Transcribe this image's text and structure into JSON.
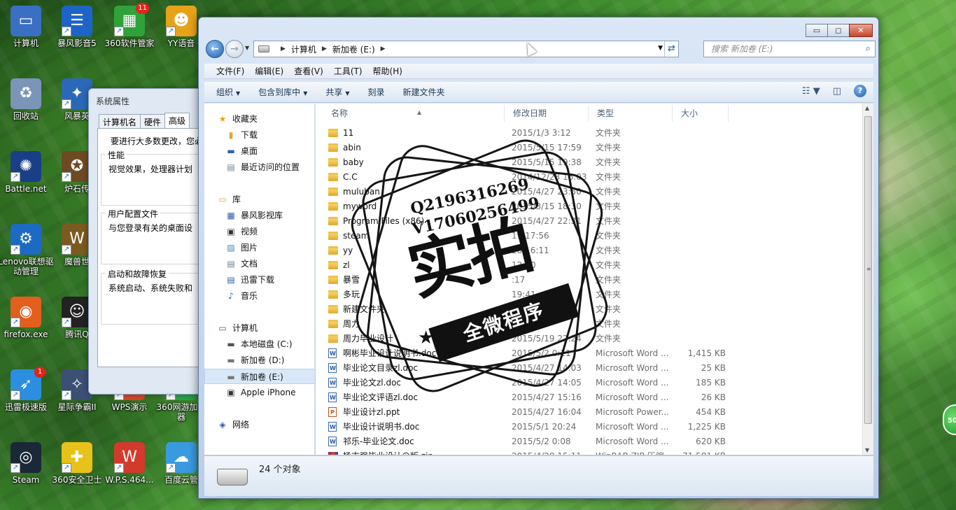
{
  "desktop": {
    "icons": [
      {
        "label": "计算机",
        "glyph": "▭",
        "color": "#3a6fc4",
        "badge": ""
      },
      {
        "label": "暴风影音5",
        "glyph": "☰",
        "color": "#1c64c8",
        "badge": ""
      },
      {
        "label": "360软件管家",
        "glyph": "▦",
        "color": "#2fa23a",
        "badge": "11"
      },
      {
        "label": "YY语音",
        "glyph": "☻",
        "color": "#e8a21a",
        "badge": ""
      },
      {
        "label": "回收站",
        "glyph": "♻",
        "color": "#7a95b8",
        "badge": ""
      },
      {
        "label": "风暴英",
        "glyph": "✦",
        "color": "#2b68b8",
        "badge": ""
      },
      {
        "label": "Battle.net",
        "glyph": "✺",
        "color": "#1b3f86",
        "badge": ""
      },
      {
        "label": "炉石传",
        "glyph": "✪",
        "color": "#6d4a22",
        "badge": ""
      },
      {
        "label": "Lenovo联想驱动管理",
        "glyph": "⚙",
        "color": "#1d6ac4",
        "badge": ""
      },
      {
        "label": "魔兽世",
        "glyph": "W",
        "color": "#7a5a20",
        "badge": ""
      },
      {
        "label": "firefox.exe",
        "glyph": "◉",
        "color": "#e25f1e",
        "badge": ""
      },
      {
        "label": "腾讯Q",
        "glyph": "☺",
        "color": "#222222",
        "badge": ""
      },
      {
        "label": "迅雷极速版",
        "glyph": "➶",
        "color": "#2b8ee0",
        "badge": "1"
      },
      {
        "label": "星际争霸II",
        "glyph": "✧",
        "color": "#3c4f74",
        "badge": ""
      },
      {
        "label": "WPS演示",
        "glyph": "P",
        "color": "#d4452b",
        "badge": ""
      },
      {
        "label": "360网游加速器",
        "glyph": "✚",
        "color": "#2aa14a",
        "badge": ""
      },
      {
        "label": "Steam",
        "glyph": "◎",
        "color": "#1b2838",
        "badge": ""
      },
      {
        "label": "360安全卫士",
        "glyph": "✚",
        "color": "#e8c21a",
        "badge": ""
      },
      {
        "label": "W.P.S.464...",
        "glyph": "W",
        "color": "#d33a2b",
        "badge": ""
      },
      {
        "label": "百度云管",
        "glyph": "☁",
        "color": "#3a9ae0",
        "badge": ""
      }
    ]
  },
  "sysprop": {
    "title": "系统属性",
    "tabs": [
      "计算机名",
      "硬件",
      "高级"
    ],
    "intro": "要进行大多数更改，您必",
    "groups": [
      {
        "title": "性能",
        "text": "视觉效果，处理器计划"
      },
      {
        "title": "用户配置文件",
        "text": "与您登录有关的桌面设"
      },
      {
        "title": "启动和故障恢复",
        "text": "系统启动、系统失败和"
      }
    ]
  },
  "explorer": {
    "caption": {
      "min": "▭",
      "max": "◻",
      "close": "✕"
    },
    "address": {
      "segments": [
        "计算机",
        "新加卷 (E:)"
      ]
    },
    "search_placeholder": "搜索 新加卷 (E:)",
    "menu": [
      "文件(F)",
      "编辑(E)",
      "查看(V)",
      "工具(T)",
      "帮助(H)"
    ],
    "toolbar": [
      {
        "label": "组织",
        "caret": true
      },
      {
        "label": "包含到库中",
        "caret": true
      },
      {
        "label": "共享",
        "caret": true
      },
      {
        "label": "刻录",
        "caret": false
      },
      {
        "label": "新建文件夹",
        "caret": false
      }
    ],
    "nav": {
      "favorites_header": "收藏夹",
      "favorites": [
        "下载",
        "桌面",
        "最近访问的位置"
      ],
      "libraries_header": "库",
      "libraries": [
        "暴风影视库",
        "视频",
        "图片",
        "文档",
        "迅雷下载",
        "音乐"
      ],
      "computer_header": "计算机",
      "drives": [
        "本地磁盘 (C:)",
        "新加卷 (D:)",
        "新加卷 (E:)",
        "Apple iPhone"
      ],
      "selected_drive": "新加卷 (E:)",
      "network_header": "网络"
    },
    "columns": {
      "name": "名称",
      "date": "修改日期",
      "type": "类型",
      "size": "大小"
    },
    "files": [
      {
        "name": "11",
        "date": "2015/1/3 3:12",
        "type": "文件夹",
        "size": "",
        "kind": "folder"
      },
      {
        "name": "abin",
        "date": "2015/5/15 17:59",
        "type": "文件夹",
        "size": "",
        "kind": "folder"
      },
      {
        "name": "baby",
        "date": "2015/5/15 19:38",
        "type": "文件夹",
        "size": "",
        "kind": "folder"
      },
      {
        "name": "C.C",
        "date": "2014/12/28 16:03",
        "type": "文件夹",
        "size": "",
        "kind": "folder"
      },
      {
        "name": "muluban",
        "date": "2015/4/27 23:50",
        "type": "文件夹",
        "size": "",
        "kind": "folder"
      },
      {
        "name": "myword",
        "date": "2015/3/15 18:30",
        "type": "文件夹",
        "size": "",
        "kind": "folder"
      },
      {
        "name": "Program Files (x86)",
        "date": "2015/4/27 22:31",
        "type": "文件夹",
        "size": "",
        "kind": "folder"
      },
      {
        "name": "steam",
        "date": "19 17:56",
        "type": "文件夹",
        "size": "",
        "kind": "folder"
      },
      {
        "name": "yy",
        "date": "28 16:11",
        "type": "文件夹",
        "size": "",
        "kind": "folder"
      },
      {
        "name": "zl",
        "date": "12:30",
        "type": "文件夹",
        "size": "",
        "kind": "folder"
      },
      {
        "name": "暴雪",
        "date": ":17",
        "type": "文件夹",
        "size": "",
        "kind": "folder"
      },
      {
        "name": "多玩",
        "date": "19:41",
        "type": "文件夹",
        "size": "",
        "kind": "folder"
      },
      {
        "name": "新建文件夹",
        "date": "0:0",
        "type": "文件夹",
        "size": "",
        "kind": "folder"
      },
      {
        "name": "周力",
        "date": "21:23",
        "type": "文件夹",
        "size": "",
        "kind": "folder"
      },
      {
        "name": "周力毕业设计",
        "date": "2015/5/19 22:24",
        "type": "文件夹",
        "size": "",
        "kind": "folder"
      },
      {
        "name": "啊彬毕业设计说明书.doc",
        "date": "2015/5/2 0:11",
        "type": "Microsoft Word ...",
        "size": "1,415 KB",
        "kind": "doc"
      },
      {
        "name": "毕业论文目录zl.doc",
        "date": "2015/4/27 14:03",
        "type": "Microsoft Word ...",
        "size": "25 KB",
        "kind": "doc"
      },
      {
        "name": "毕业论文zl.doc",
        "date": "2015/4/27 14:05",
        "type": "Microsoft Word ...",
        "size": "185 KB",
        "kind": "doc"
      },
      {
        "name": "毕业论文评语zl.doc",
        "date": "2015/4/27 15:16",
        "type": "Microsoft Word ...",
        "size": "26 KB",
        "kind": "doc"
      },
      {
        "name": "毕业设计zl.ppt",
        "date": "2015/4/27 16:04",
        "type": "Microsoft Power...",
        "size": "454 KB",
        "kind": "ppt"
      },
      {
        "name": "毕业设计说明书.doc",
        "date": "2015/5/1 20:24",
        "type": "Microsoft Word ...",
        "size": "1,225 KB",
        "kind": "doc"
      },
      {
        "name": "祁乐-毕业论文.doc",
        "date": "2015/5/2 0:08",
        "type": "Microsoft Word ...",
        "size": "620 KB",
        "kind": "doc"
      },
      {
        "name": "杨志强毕业设计@版.zip",
        "date": "2015/4/28 15:11",
        "type": "WinRAR ZIP 压缩...",
        "size": "71,581 KB",
        "kind": "zip"
      }
    ],
    "status": "24 个对象"
  },
  "watermark": {
    "line1": "Q2196316269",
    "line2": "V17060256499",
    "big": "实拍",
    "banner": "全微程序"
  },
  "side_badge": "50"
}
